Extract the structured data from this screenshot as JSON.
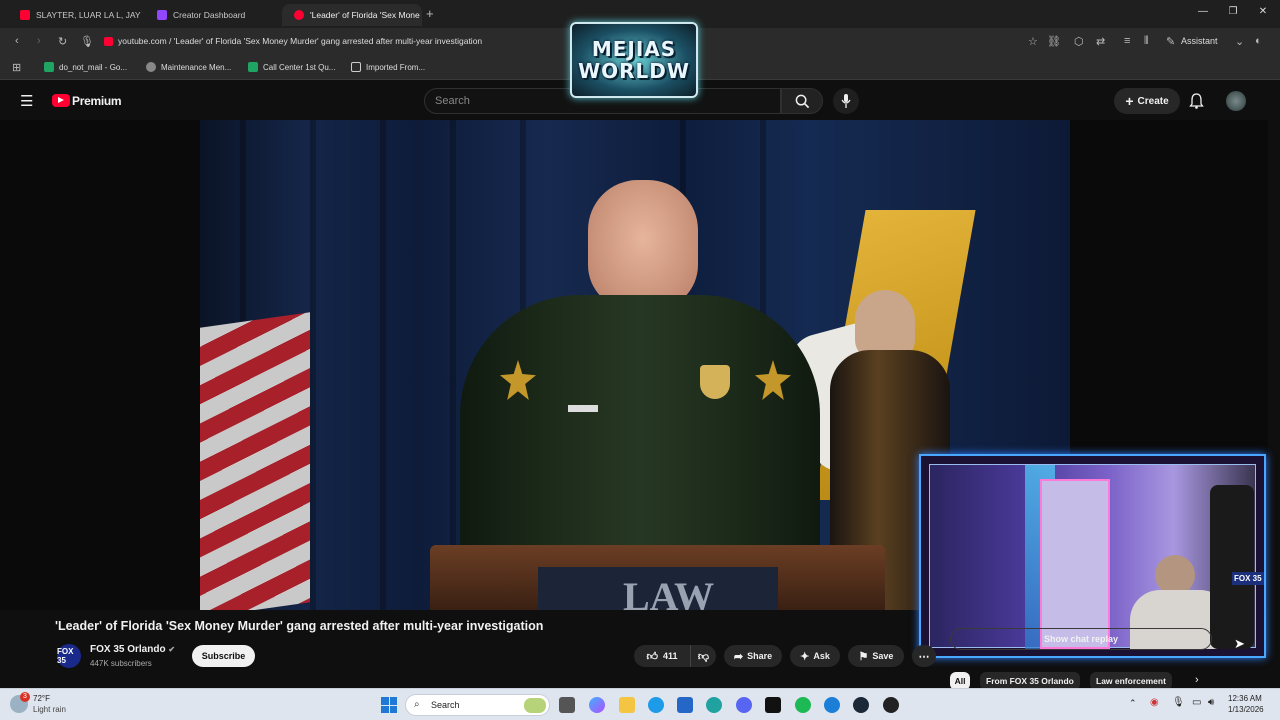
{
  "browser": {
    "tabs": [
      {
        "label": "SLAYTER, LUAR LA L, JAY WH",
        "favicon_color": "#ff0033"
      },
      {
        "label": "Creator Dashboard",
        "favicon_color": "#9146ff"
      },
      {
        "label": "'Leader' of Florida 'Sex Mone",
        "favicon_color": "#ff0033"
      }
    ],
    "url": "youtube.com / 'Leader' of Florida 'Sex Money Murder' gang arrested after multi-year investigation",
    "assistant_label": "Assistant",
    "bookmarks": [
      {
        "label": "do_not_mail - Go...",
        "icon_color": "#1fa463"
      },
      {
        "label": "Maintenance Men...",
        "icon_color": "#888888"
      },
      {
        "label": "Call Center 1st Qu...",
        "icon_color": "#1fa463"
      },
      {
        "label": "Imported From...",
        "icon_color": "#cccccc"
      }
    ]
  },
  "overlay_logo": {
    "line1": "MEJIAS",
    "line2": "WORLDW"
  },
  "youtube": {
    "brand": "Premium",
    "search_placeholder": "Search",
    "create_label": "Create",
    "video": {
      "title": "'Leader' of Florida 'Sex Money Murder' gang arrested after multi-year investigation",
      "podium_text": "LAW",
      "watermark": "FOX 35"
    },
    "channel": {
      "name": "FOX 35 Orlando",
      "logo_text": "FOX 35",
      "subscribers": "447K subscribers"
    },
    "subscribe_label": "Subscribe",
    "likes": "411",
    "share_label": "Share",
    "ask_label": "Ask",
    "save_label": "Save",
    "show_chat_replay": "Show chat replay",
    "chips": [
      "All",
      "From FOX 35 Orlando",
      "Law enforcement"
    ]
  },
  "taskbar": {
    "weather_temp": "72°F",
    "weather_desc": "Light rain",
    "weather_badge": "3",
    "search_label": "Search",
    "time": "12:36 AM",
    "date": "1/13/2026"
  }
}
